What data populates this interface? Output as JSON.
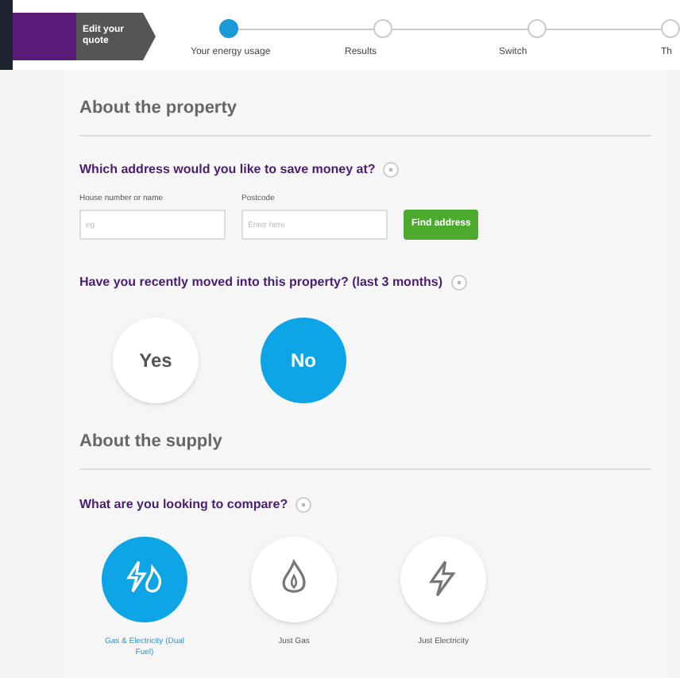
{
  "header": {
    "edit_tab": "Edit your quote"
  },
  "steps": [
    {
      "label": "Your energy usage",
      "selected": true
    },
    {
      "label": "Results",
      "selected": false
    },
    {
      "label": "Switch",
      "selected": false
    },
    {
      "label": "Th",
      "selected": false
    }
  ],
  "property": {
    "heading": "About the property",
    "address_question": "Which address would you like to save money at?",
    "fields": [
      {
        "label": "House number or name",
        "placeholder": "eg"
      },
      {
        "label": "Postcode",
        "placeholder": "Enter here"
      }
    ],
    "find_button": "Find address",
    "moved_question": "Have you recently moved into this property? (last 3 months)",
    "moved_options": [
      {
        "label": "Yes",
        "selected": false
      },
      {
        "label": "No",
        "selected": true
      }
    ]
  },
  "supply": {
    "heading": "About the supply",
    "question": "What are you looking to compare?",
    "options": [
      {
        "kind": "dual",
        "label": "Gas & Electricity (Dual Fuel)",
        "selected": true
      },
      {
        "kind": "gas",
        "label": "Just Gas",
        "selected": false
      },
      {
        "kind": "electricity",
        "label": "Just Electricity",
        "selected": false
      }
    ]
  }
}
